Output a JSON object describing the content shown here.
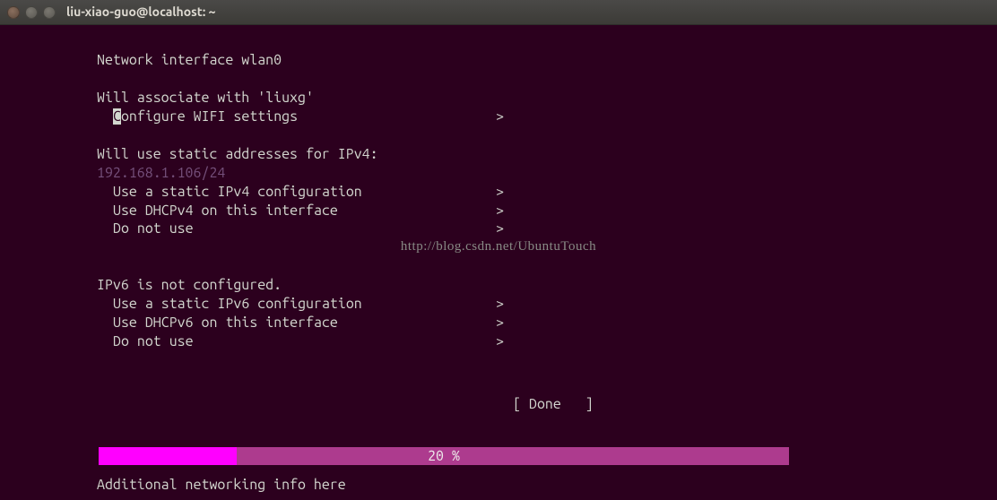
{
  "titlebar": {
    "title": "liu-xiao-guo@localhost: ~"
  },
  "header": {
    "interface_line": "Network interface wlan0"
  },
  "wifi": {
    "associate_line": "Will associate with 'liuxg'",
    "configure_prefix": "C",
    "configure_rest": "onfigure WIFI settings",
    "arrow": ">"
  },
  "ipv4": {
    "header": "Will use static addresses for IPv4:",
    "address": "192.168.1.106/24",
    "opt_static": "Use a static IPv4 configuration",
    "opt_dhcp": "Use DHCPv4 on this interface",
    "opt_none": "Do not use"
  },
  "watermark": {
    "text": "http://blog.csdn.net/UbuntuTouch"
  },
  "ipv6": {
    "header": "IPv6 is not configured.",
    "opt_static": "Use a static IPv6 configuration",
    "opt_dhcp": "Use DHCPv6 on this interface",
    "opt_none": "Do not use"
  },
  "done": {
    "label": "[ Done   ]"
  },
  "progress": {
    "percent_label": "20 %"
  },
  "footer": {
    "text": "Additional networking info here"
  },
  "arrow": ">"
}
